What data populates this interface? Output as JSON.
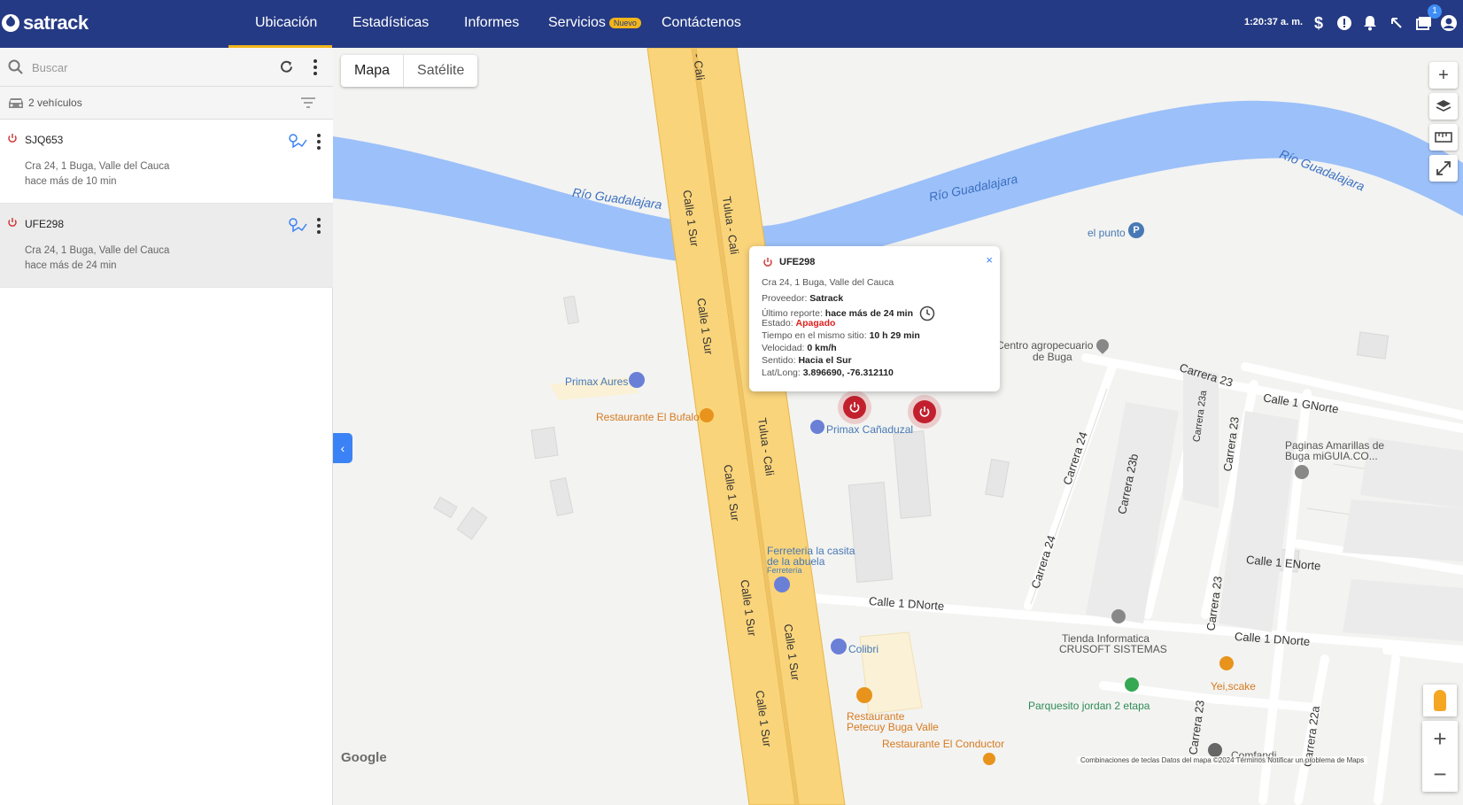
{
  "app": {
    "brand": "satrack"
  },
  "nav": {
    "items": [
      "Ubicación",
      "Estadísticas",
      "Informes",
      "Servicios",
      "Contáctenos"
    ],
    "active": "Ubicación",
    "new_badge": "Nuevo"
  },
  "header": {
    "time": "1:20:37 a. m.",
    "notification_count": "1",
    "icons": [
      "dollar-icon",
      "alert-icon",
      "bell-icon",
      "arrow-icon",
      "folder-icon",
      "account-icon"
    ]
  },
  "sidebar": {
    "search_placeholder": "Buscar",
    "vehicle_count": "2 vehículos",
    "vehicles": [
      {
        "plate": "SJQ653",
        "address": "Cra 24, 1 Buga, Valle del Cauca",
        "ago": "hace más de 10 min"
      },
      {
        "plate": "UFE298",
        "address": "Cra 24, 1 Buga, Valle del Cauca",
        "ago": "hace más de 24 min"
      }
    ]
  },
  "map": {
    "type_options": [
      "Mapa",
      "Satélite"
    ],
    "selected_type": "Mapa",
    "popup": {
      "plate": "UFE298",
      "address": "Cra 24, 1 Buga, Valle del Cauca",
      "provider_label": "Proveedor:",
      "provider": "Satrack",
      "report_label": "Último reporte:",
      "report": "hace más de 24 min",
      "status_label": "Estado:",
      "status": "Apagado",
      "time_label": "Tiempo en el mismo sitio:",
      "time": "10 h 29 min",
      "speed_label": "Velocidad:",
      "speed": "0 km/h",
      "direction_label": "Sentido:",
      "direction": "Hacia el Sur",
      "latlong_label": "Lat/Long:",
      "latlong": "3.896690, -76.312110",
      "close": "×"
    },
    "labels": {
      "river1": "Río Guadalajara",
      "river2": "Río Guadalajara",
      "river3": "Río Guadalajara",
      "elpunto": "el punto",
      "centro": "Centro agropecuario",
      "centro2": "de Buga",
      "primax_aures": "Primax Aures",
      "bufalo": "Restaurante El Bufalo",
      "primax_canaduzal": "Primax Cañaduzal",
      "ferreteria1": "Ferreteria la casita",
      "ferreteria2": "de la abuela",
      "ferreteria3": "Ferretería",
      "colibri": "Colibri",
      "petecuy1": "Restaurante",
      "petecuy2": "Petecuy Buga Valle",
      "conductor": "Restaurante El Conductor",
      "tienda1": "Tienda Informatica",
      "tienda2": "CRUSOFT SISTEMAS",
      "paginas1": "Paginas Amarillas de",
      "paginas2": "Buga miGUIA.CO...",
      "yei": "Yei,scake",
      "parquesito": "Parquesito jordan 2 etapa",
      "comfandi": "Comfandi"
    },
    "roads": {
      "cali": "- Cali",
      "calle1sur_a": "Calle 1 Sur",
      "calle1sur_b": "Calle 1 Sur",
      "calle1sur_c": "Calle 1 Sur",
      "calle1sur_d": "Calle 1 Sur",
      "calle1sur_e": "Calle 1 Sur",
      "calle1sur_f": "Calle 1 Sur",
      "tulua_cali_a": "Tulua - Cali",
      "tulua_cali_b": "Tulua - Cali",
      "carrera23_a": "Carrera 23",
      "calle1gnorte": "Calle 1 GNorte",
      "calle1enorte": "Calle 1 ENorte",
      "calle1dnorte_a": "Calle 1 DNorte",
      "calle1dnorte_b": "Calle 1 DNorte",
      "carrera24_a": "Carrera 24",
      "carrera24_b": "Carrera 24",
      "carrera23b": "Carrera 23b",
      "carrera23a": "Carrera 23a",
      "carrera23_b": "Carrera 23",
      "carrera23_c": "Carrera 23",
      "carrera23_d": "Carrera 23",
      "carrera22a": "Carrera 22a"
    },
    "google": "Google",
    "attribution": "Combinaciones de teclas    Datos del mapa ©2024    Términos    Notificar un problema de Maps"
  },
  "colors": {
    "topbar": "#253a84",
    "accent": "#f2b51b",
    "river": "#9cc0f9",
    "highway": "#fad47a",
    "marker": "#c2202e"
  }
}
